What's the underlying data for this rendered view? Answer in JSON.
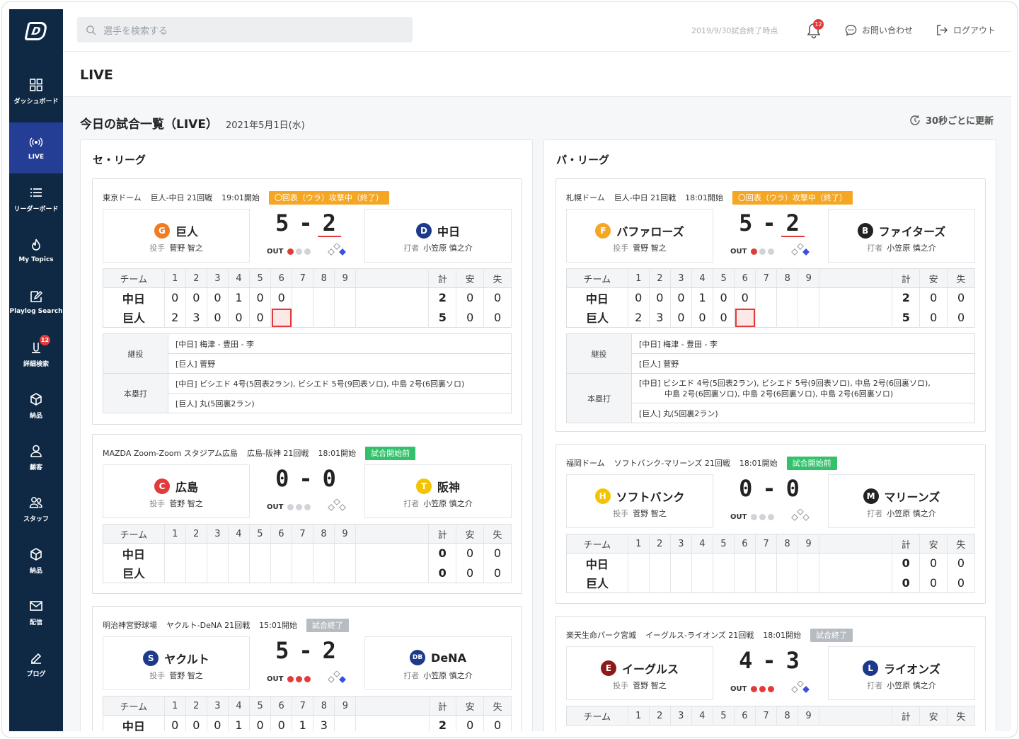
{
  "sidebar": {
    "items": [
      {
        "label": "ダッシュボード",
        "icon": "grid-icon"
      },
      {
        "label": "LIVE",
        "icon": "live-icon"
      },
      {
        "label": "リーダーボード",
        "icon": "list-icon"
      },
      {
        "label": "My Topics",
        "icon": "flame-icon"
      },
      {
        "label": "Playlog Search",
        "icon": "edit-icon"
      },
      {
        "label": "詳細検索",
        "icon": "detail-search-icon",
        "badge": "12"
      },
      {
        "label": "納品",
        "icon": "box-icon"
      },
      {
        "label": "顧客",
        "icon": "user-icon"
      },
      {
        "label": "スタッフ",
        "icon": "users-icon"
      },
      {
        "label": "納品",
        "icon": "box-icon"
      },
      {
        "label": "配信",
        "icon": "mail-icon"
      },
      {
        "label": "ブログ",
        "icon": "pen-icon"
      }
    ]
  },
  "header": {
    "search_placeholder": "選手を検索する",
    "date_note": "2019/9/30試合終了時点",
    "bell_badge": "12",
    "contact": "お問い合わせ",
    "logout": "ログアウト"
  },
  "page": {
    "title": "LIVE",
    "section_title": "今日の試合一覧（LIVE）",
    "section_date": "2021年5月1日(水)",
    "refresh": "30秒ごとに更新"
  },
  "leagues": [
    {
      "title": "セ・リーグ",
      "games": [
        {
          "venue": "東京ドーム",
          "matchup": "巨人-中日 21回戦",
          "start": "19:01開始",
          "status": "〇回表（ウラ）攻撃中（終了）",
          "status_type": "live",
          "home": {
            "name": "巨人",
            "logo": "G",
            "color": "#f47a20",
            "role": "投手",
            "player": "菅野 智之"
          },
          "away": {
            "name": "中日",
            "logo": "D",
            "color": "#1d3a8a",
            "role": "打者",
            "player": "小笠原 慎之介"
          },
          "score_home": "5",
          "score_sep": "-",
          "score_away": "2",
          "outs": 1,
          "box_header": [
            "チーム",
            "1",
            "2",
            "3",
            "4",
            "5",
            "6",
            "7",
            "8",
            "9",
            "",
            "計",
            "安",
            "失"
          ],
          "rows": [
            {
              "team": "中日",
              "innings": [
                "0",
                "0",
                "0",
                "1",
                "0",
                "0",
                "",
                "",
                ""
              ],
              "r": "2",
              "h": "0",
              "e": "0"
            },
            {
              "team": "巨人",
              "innings": [
                "2",
                "3",
                "0",
                "0",
                "0",
                "",
                "",
                "",
                ""
              ],
              "r": "5",
              "h": "0",
              "e": "0"
            }
          ],
          "notes": [
            {
              "label": "継投",
              "lines": [
                "[中日] 梅津 - 豊田 - 李",
                "[巨人] 菅野"
              ]
            },
            {
              "label": "本塁打",
              "lines": [
                "[中日] ビシエド 4号(5回表2ラン), ビシエド 5号(9回表ソロ), 中島 2号(6回裏ソロ)",
                "[巨人] 丸(5回裏2ラン)"
              ]
            }
          ]
        },
        {
          "venue": "MAZDA Zoom-Zoom スタジアム広島",
          "matchup": "広島-阪神 21回戦",
          "start": "18:01開始",
          "status": "試合開始前",
          "status_type": "pre",
          "home": {
            "name": "広島",
            "logo": "C",
            "color": "#e23b3b",
            "role": "投手",
            "player": "菅野 智之"
          },
          "away": {
            "name": "阪神",
            "logo": "T",
            "color": "#f5c400",
            "role": "打者",
            "player": "小笠原 慎之介"
          },
          "score_home": "0",
          "score_sep": "-",
          "score_away": "0",
          "outs": 0,
          "box_header": [
            "チーム",
            "1",
            "2",
            "3",
            "4",
            "5",
            "6",
            "7",
            "8",
            "9",
            "",
            "計",
            "安",
            "失"
          ],
          "rows": [
            {
              "team": "中日",
              "innings": [
                "",
                "",
                "",
                "",
                "",
                "",
                "",
                "",
                ""
              ],
              "r": "0",
              "h": "0",
              "e": "0"
            },
            {
              "team": "巨人",
              "innings": [
                "",
                "",
                "",
                "",
                "",
                "",
                "",
                "",
                ""
              ],
              "r": "0",
              "h": "0",
              "e": "0"
            }
          ]
        },
        {
          "venue": "明治神宮野球場",
          "matchup": "ヤクルト-DeNA 21回戦",
          "start": "15:01開始",
          "status": "試合終了",
          "status_type": "end",
          "home": {
            "name": "ヤクルト",
            "logo": "S",
            "color": "#1d3a8a",
            "role": "投手",
            "player": "菅野 智之"
          },
          "away": {
            "name": "DeNA",
            "logo": "DB",
            "color": "#1d3a8a",
            "role": "打者",
            "player": "小笠原 慎之介"
          },
          "score_home": "5",
          "score_sep": "-",
          "score_away": "2",
          "outs": 3,
          "box_header": [
            "チーム",
            "1",
            "2",
            "3",
            "4",
            "5",
            "6",
            "7",
            "8",
            "9",
            "",
            "計",
            "安",
            "失"
          ],
          "rows": [
            {
              "team": "中日",
              "innings": [
                "0",
                "0",
                "0",
                "1",
                "0",
                "0",
                "1",
                "3",
                ""
              ],
              "r": "2",
              "h": "0",
              "e": "0"
            }
          ]
        }
      ]
    },
    {
      "title": "パ・リーグ",
      "games": [
        {
          "venue": "札幌ドーム",
          "matchup": "巨人-中日 21回戦",
          "start": "18:01開始",
          "status": "〇回表（ウラ）攻撃中（終了）",
          "status_type": "live",
          "home": {
            "name": "バファローズ",
            "logo": "F",
            "color": "#f5a623",
            "role": "投手",
            "player": "菅野 智之"
          },
          "away": {
            "name": "ファイターズ",
            "logo": "B",
            "color": "#222",
            "role": "打者",
            "player": "小笠原 慎之介"
          },
          "score_home": "5",
          "score_sep": "-",
          "score_away": "2",
          "outs": 1,
          "box_header": [
            "チーム",
            "1",
            "2",
            "3",
            "4",
            "5",
            "6",
            "7",
            "8",
            "9",
            "",
            "計",
            "安",
            "失"
          ],
          "rows": [
            {
              "team": "中日",
              "innings": [
                "0",
                "0",
                "0",
                "1",
                "0",
                "0",
                "",
                "",
                ""
              ],
              "r": "2",
              "h": "0",
              "e": "0"
            },
            {
              "team": "巨人",
              "innings": [
                "2",
                "3",
                "0",
                "0",
                "0",
                "",
                "",
                "",
                ""
              ],
              "r": "5",
              "h": "0",
              "e": "0"
            }
          ],
          "notes": [
            {
              "label": "継投",
              "lines": [
                "[中日] 梅津 - 豊田 - 李",
                "[巨人] 菅野"
              ]
            },
            {
              "label": "本塁打",
              "lines": [
                "[中日] ビシエド 4号(5回表2ラン), ビシエド 5号(9回表ソロ), 中島 2号(6回裏ソロ),",
                "中島 2号(6回裏ソロ), 中島 2号(6回裏ソロ), 中島 2号(6回裏ソロ)",
                "[巨人] 丸(5回裏2ラン)"
              ]
            }
          ]
        },
        {
          "venue": "福岡ドーム",
          "matchup": "ソフトバンク-マリーンズ 21回戦",
          "start": "18:01開始",
          "status": "試合開始前",
          "status_type": "pre",
          "home": {
            "name": "ソフトバンク",
            "logo": "H",
            "color": "#f5c400",
            "role": "投手",
            "player": "菅野 智之"
          },
          "away": {
            "name": "マリーンズ",
            "logo": "M",
            "color": "#222",
            "role": "打者",
            "player": "小笠原 慎之介"
          },
          "score_home": "0",
          "score_sep": "-",
          "score_away": "0",
          "outs": 0,
          "box_header": [
            "チーム",
            "1",
            "2",
            "3",
            "4",
            "5",
            "6",
            "7",
            "8",
            "9",
            "",
            "計",
            "安",
            "失"
          ],
          "rows": [
            {
              "team": "中日",
              "innings": [
                "",
                "",
                "",
                "",
                "",
                "",
                "",
                "",
                ""
              ],
              "r": "0",
              "h": "0",
              "e": "0"
            },
            {
              "team": "巨人",
              "innings": [
                "",
                "",
                "",
                "",
                "",
                "",
                "",
                "",
                ""
              ],
              "r": "0",
              "h": "0",
              "e": "0"
            }
          ]
        },
        {
          "venue": "楽天生命パーク宮城",
          "matchup": "イーグルス-ライオンズ 21回戦",
          "start": "18:01開始",
          "status": "試合終了",
          "status_type": "end",
          "home": {
            "name": "イーグルス",
            "logo": "E",
            "color": "#8b1a1a",
            "role": "投手",
            "player": "菅野 智之"
          },
          "away": {
            "name": "ライオンズ",
            "logo": "L",
            "color": "#1d3a8a",
            "role": "打者",
            "player": "小笠原 慎之介"
          },
          "score_home": "4",
          "score_sep": "-",
          "score_away": "3",
          "outs": 3,
          "box_header": [
            "チーム",
            "1",
            "2",
            "3",
            "4",
            "5",
            "6",
            "7",
            "8",
            "9",
            "",
            "計",
            "安",
            "失"
          ],
          "rows": []
        }
      ]
    }
  ]
}
